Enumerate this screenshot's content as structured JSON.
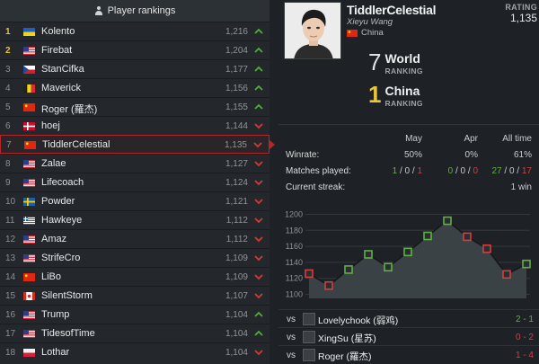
{
  "rankings": {
    "header": "Player rankings",
    "rows": [
      {
        "rank": "1",
        "flag": "ukraine",
        "name": "Kolento",
        "rating": "1,216",
        "trend": "up"
      },
      {
        "rank": "2",
        "flag": "usa",
        "name": "Firebat",
        "rating": "1,204",
        "trend": "up"
      },
      {
        "rank": "3",
        "flag": "czech",
        "name": "StanCifka",
        "rating": "1,177",
        "trend": "up"
      },
      {
        "rank": "4",
        "flag": "belgium",
        "name": "Maverick",
        "rating": "1,156",
        "trend": "up"
      },
      {
        "rank": "5",
        "flag": "china",
        "name": "Roger (羅杰)",
        "rating": "1,155",
        "trend": "up"
      },
      {
        "rank": "6",
        "flag": "denmark",
        "name": "hoej",
        "rating": "1,144",
        "trend": "down"
      },
      {
        "rank": "7",
        "flag": "china",
        "name": "TiddlerCelestial",
        "rating": "1,135",
        "trend": "down",
        "selected": true
      },
      {
        "rank": "8",
        "flag": "usa",
        "name": "Zalae",
        "rating": "1,127",
        "trend": "down"
      },
      {
        "rank": "9",
        "flag": "usa",
        "name": "Lifecoach",
        "rating": "1,124",
        "trend": "down"
      },
      {
        "rank": "10",
        "flag": "sweden",
        "name": "Powder",
        "rating": "1,121",
        "trend": "down"
      },
      {
        "rank": "11",
        "flag": "greece",
        "name": "Hawkeye",
        "rating": "1,112",
        "trend": "down"
      },
      {
        "rank": "12",
        "flag": "usa",
        "name": "Amaz",
        "rating": "1,112",
        "trend": "down"
      },
      {
        "rank": "13",
        "flag": "usa",
        "name": "StrifeCro",
        "rating": "1,109",
        "trend": "down"
      },
      {
        "rank": "14",
        "flag": "china",
        "name": "LiBo",
        "rating": "1,109",
        "trend": "down"
      },
      {
        "rank": "15",
        "flag": "canada",
        "name": "SilentStorm",
        "rating": "1,107",
        "trend": "down"
      },
      {
        "rank": "16",
        "flag": "usa",
        "name": "Trump",
        "rating": "1,104",
        "trend": "up"
      },
      {
        "rank": "17",
        "flag": "usa",
        "name": "TidesofTime",
        "rating": "1,104",
        "trend": "up"
      },
      {
        "rank": "18",
        "flag": "poland",
        "name": "Lothar",
        "rating": "1,104",
        "trend": "down"
      }
    ]
  },
  "profile": {
    "name": "TiddlerCelestial",
    "real_name": "Xieyu Wang",
    "country": "China",
    "rating_label": "RATING",
    "rating": "1,135",
    "world_rank": "7",
    "world_label": "World",
    "country_rank": "1",
    "country_label": "China",
    "ranking_label": "RANKING"
  },
  "stats": {
    "columns": [
      "May",
      "Apr",
      "All time"
    ],
    "winrate": {
      "label": "Winrate:",
      "values": [
        "50%",
        "0%",
        "61%"
      ]
    },
    "matches": {
      "label": "Matches played:",
      "values": [
        [
          "1",
          "0",
          "1"
        ],
        [
          "0",
          "0",
          "0"
        ],
        [
          "27",
          "0",
          "17"
        ]
      ]
    },
    "streak": {
      "label": "Current streak:",
      "value": "1 win"
    }
  },
  "chart_data": {
    "type": "line",
    "yticks": [
      1100,
      1120,
      1140,
      1160,
      1180,
      1200
    ],
    "ylim": [
      1095,
      1205
    ],
    "points": [
      1126,
      1111,
      1131,
      1150,
      1134,
      1153,
      1173,
      1192,
      1172,
      1157,
      1125,
      1138
    ],
    "marker_results": [
      "loss",
      "loss",
      "win",
      "win",
      "win",
      "win",
      "win",
      "win",
      "loss",
      "loss",
      "loss",
      "win"
    ]
  },
  "matches": [
    {
      "vs": "vs",
      "opponent": "Lovelychook (弱鸡)",
      "score": "2 - 1",
      "result": "win"
    },
    {
      "vs": "vs",
      "opponent": "XingSu (星苏)",
      "score": "0 - 2",
      "result": "loss"
    },
    {
      "vs": "vs",
      "opponent": "Roger (羅杰)",
      "score": "1 - 4",
      "result": "loss"
    }
  ],
  "colors": {
    "win": "#5fb043",
    "loss": "#d33f3f",
    "gold": "#e8c53a",
    "selected_border": "#b3262a"
  }
}
